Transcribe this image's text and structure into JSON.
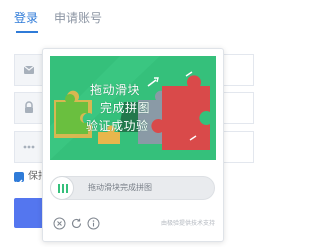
{
  "tabs": [
    {
      "label": "登录",
      "active": true
    },
    {
      "label": "申请账号",
      "active": false
    }
  ],
  "form": {
    "user_icon": "envelope-icon",
    "password_icon": "lock-icon",
    "captcha_icon": "ellipsis-icon",
    "remember_label": "保持",
    "remember_checked": true
  },
  "captcha": {
    "puzzle_text": [
      "拖动滑块",
      "完成拼图",
      "验证成功验"
    ],
    "slider_hint": "拖动滑块完成拼图",
    "footer_icons": [
      "close-circle-icon",
      "refresh-icon",
      "info-icon"
    ],
    "credit": "由极验提供技术支持"
  },
  "colors": {
    "accent": "#2f7bd8",
    "puzzle_bg": "#35c07b",
    "piece_red": "#d94a4a",
    "piece_gray": "#8a9aa6",
    "piece_yellow": "#e9b64c",
    "submit": "#5476ef"
  }
}
